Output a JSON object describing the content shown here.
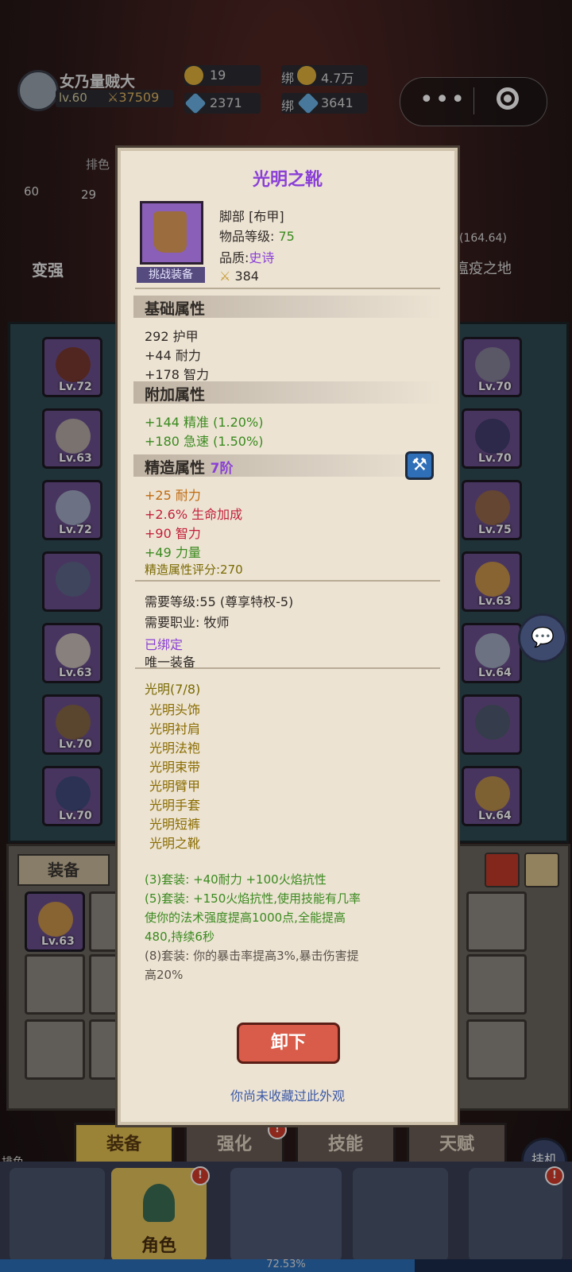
{
  "player": {
    "name": "女乃量贼大",
    "level": "lv.60",
    "power": "37509"
  },
  "currency": {
    "gold": "19",
    "bound_gold_prefix": "绑",
    "bound_gold": "4.7万",
    "diamond": "2371",
    "bound_diamond_prefix": "绑",
    "bound_diamond": "3641"
  },
  "menu_capsule": {
    "dots": "•••"
  },
  "bg_labels": {
    "rank": "排色",
    "level_num": "60",
    "hp_num": "29",
    "coords": "(164.64)",
    "zone": "瘟疫之地",
    "become_stronger": "变强",
    "rank_bottom": "排色"
  },
  "left_slots": [
    {
      "name": "cloak-slot",
      "level": "Lv.72"
    },
    {
      "name": "necklace-slot",
      "level": "Lv.63"
    },
    {
      "name": "shoulder-slot",
      "level": "Lv.72"
    },
    {
      "name": "chest-slot",
      "level": ""
    },
    {
      "name": "shirt-slot",
      "level": "Lv.63"
    },
    {
      "name": "bracer-slot",
      "level": "Lv.70"
    },
    {
      "name": "glove-slot",
      "level": "Lv.70"
    }
  ],
  "right_slots": [
    {
      "name": "belt-slot",
      "level": "Lv.70"
    },
    {
      "name": "legs-slot",
      "level": "Lv.70"
    },
    {
      "name": "boots-slot",
      "level": "Lv.75"
    },
    {
      "name": "ring1-slot",
      "level": "Lv.63"
    },
    {
      "name": "ring2-slot",
      "level": "Lv.64"
    },
    {
      "name": "trinket-slot",
      "level": ""
    },
    {
      "name": "trinket2-slot",
      "level": "Lv.64"
    }
  ],
  "bag": {
    "tab_label": "装备",
    "first_item_level": "Lv.63"
  },
  "bottom_tabs": [
    "装备",
    "强化",
    "技能",
    "天赋"
  ],
  "idle_button": "挂机",
  "nav": {
    "role_label": "角色",
    "badge": "!"
  },
  "progress": {
    "text": "72.53%",
    "fraction": 0.7253
  },
  "item": {
    "name": "光明之靴",
    "slot": "脚部 [布甲]",
    "item_level_label": "物品等级:",
    "item_level": "75",
    "quality_label": "品质:",
    "quality": "史诗",
    "score": "384",
    "challenge_tag": "挑战装备",
    "base_header": "基础属性",
    "base": [
      "292 护甲",
      "+44 耐力",
      "+178 智力"
    ],
    "extra_header": "附加属性",
    "extra": [
      "+144 精准 (1.20%)",
      "+180 急速 (1.50%)"
    ],
    "refine_header": "精造属性",
    "refine_tier": "7阶",
    "refine": [
      {
        "text": "+25 耐力",
        "color": "#c06a10"
      },
      {
        "text": "+2.6% 生命加成",
        "color": "#c3203a"
      },
      {
        "text": "+90 智力",
        "color": "#c3203a"
      },
      {
        "text": "+49 力量",
        "color": "#3a8a1e"
      }
    ],
    "refine_score": "精造属性评分:270",
    "req_level": "需要等级:55 (尊享特权-5)",
    "req_class": "需要职业: 牧师",
    "bound": "已绑定",
    "unique": "唯一装备",
    "set_title": "光明(7/8)",
    "set_pieces": [
      "光明头饰",
      "光明衬肩",
      "光明法袍",
      "光明束带",
      "光明臂甲",
      "光明手套",
      "光明短裤",
      "光明之靴"
    ],
    "set_bonus_3": "(3)套装: +40耐力 +100火焰抗性",
    "set_bonus_5_line1": "(5)套装: +150火焰抗性,使用技能有几率",
    "set_bonus_5_line2": "使你的法术强度提高1000点,全能提高",
    "set_bonus_5_line3": "480,持续6秒",
    "set_bonus_8_line1": "(8)套装: 你的暴击率提高3%,暴击伤害提",
    "set_bonus_8_line2": "高20%",
    "unequip_label": "卸下",
    "collection_note": "你尚未收藏过此外观"
  }
}
